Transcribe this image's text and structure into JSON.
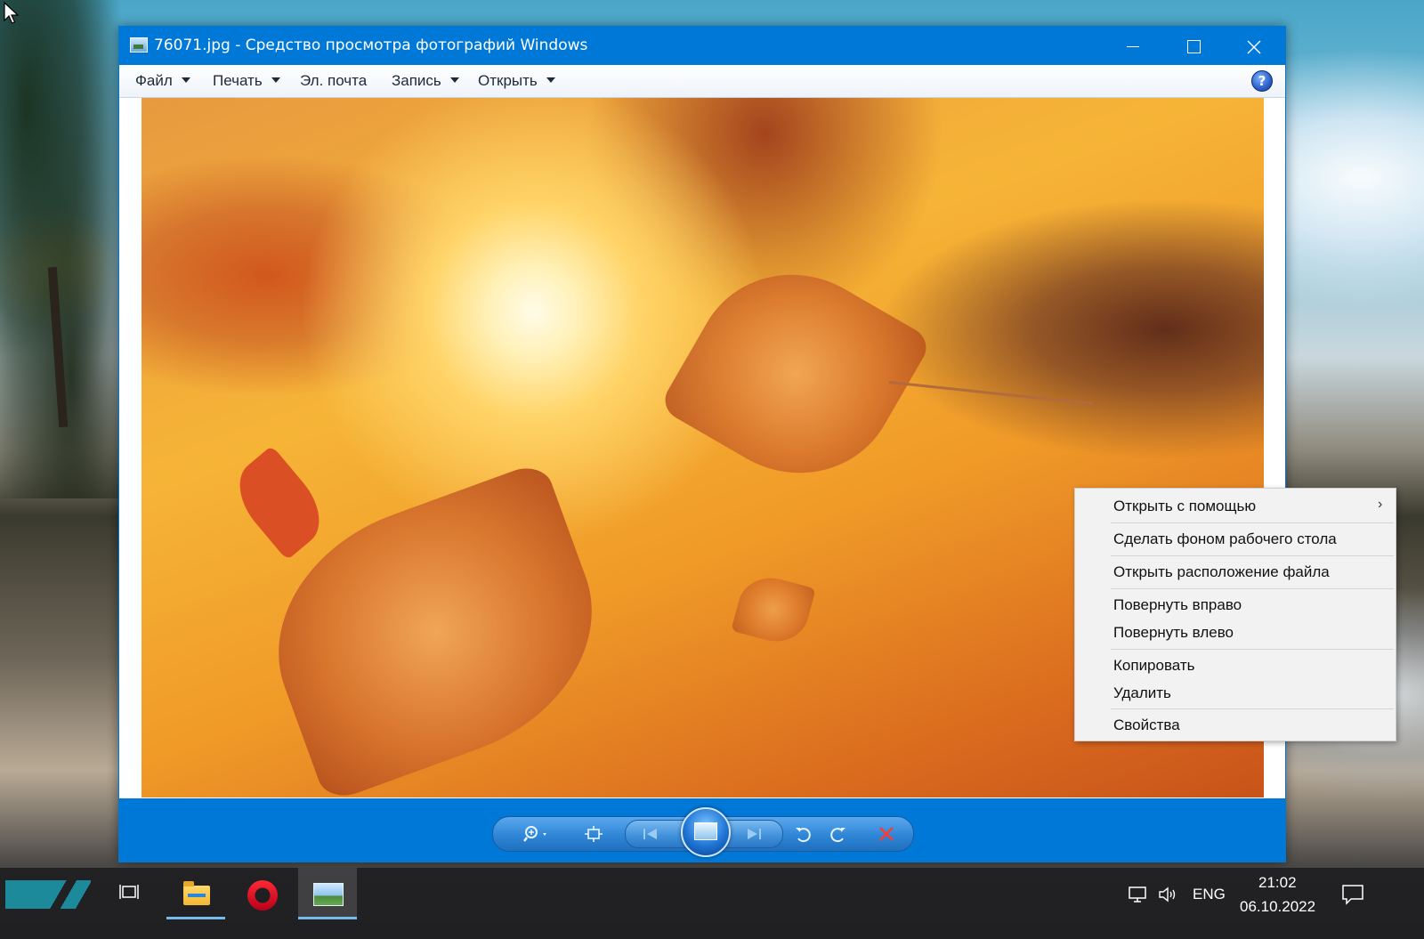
{
  "window": {
    "title": "76071.jpg - Средство просмотра фотографий Windows",
    "controls": {
      "minimize": "minimize",
      "maximize": "maximize",
      "close": "close"
    }
  },
  "menubar": {
    "items": [
      {
        "label": "Файл",
        "has_dropdown": true
      },
      {
        "label": "Печать",
        "has_dropdown": true
      },
      {
        "label": "Эл. почта",
        "has_dropdown": false
      },
      {
        "label": "Запись",
        "has_dropdown": true
      },
      {
        "label": "Открыть",
        "has_dropdown": true
      }
    ],
    "help": "?"
  },
  "viewer": {
    "image_description_icon": "autumn-leaves-photo"
  },
  "controlbar": {
    "buttons": [
      {
        "name": "zoom",
        "icon": "magnifier-icon"
      },
      {
        "name": "actual-size",
        "icon": "fit-window-icon"
      },
      {
        "name": "previous",
        "icon": "previous-icon"
      },
      {
        "name": "slideshow",
        "icon": "slideshow-icon"
      },
      {
        "name": "next",
        "icon": "next-icon"
      },
      {
        "name": "rotate-left",
        "icon": "rotate-ccw-icon"
      },
      {
        "name": "rotate-right",
        "icon": "rotate-cw-icon"
      },
      {
        "name": "delete",
        "icon": "delete-icon"
      }
    ]
  },
  "context_menu": {
    "items": [
      {
        "label": "Открыть с помощью",
        "submenu": true
      },
      {
        "label": "Сделать фоном рабочего стола"
      },
      {
        "label": "Открыть расположение файла"
      },
      {
        "label": "Повернуть вправо"
      },
      {
        "label": "Повернуть влево"
      },
      {
        "label": "Копировать"
      },
      {
        "label": "Удалить"
      },
      {
        "label": "Свойства"
      }
    ],
    "submenu_arrow": "›"
  },
  "taskbar": {
    "language": "ENG",
    "time": "21:02",
    "date": "06.10.2022",
    "apps": [
      "task-view",
      "file-explorer",
      "opera",
      "photo-viewer"
    ],
    "colors": {
      "accent": "#0078d7",
      "active_indicator": "#76b9ed"
    }
  }
}
